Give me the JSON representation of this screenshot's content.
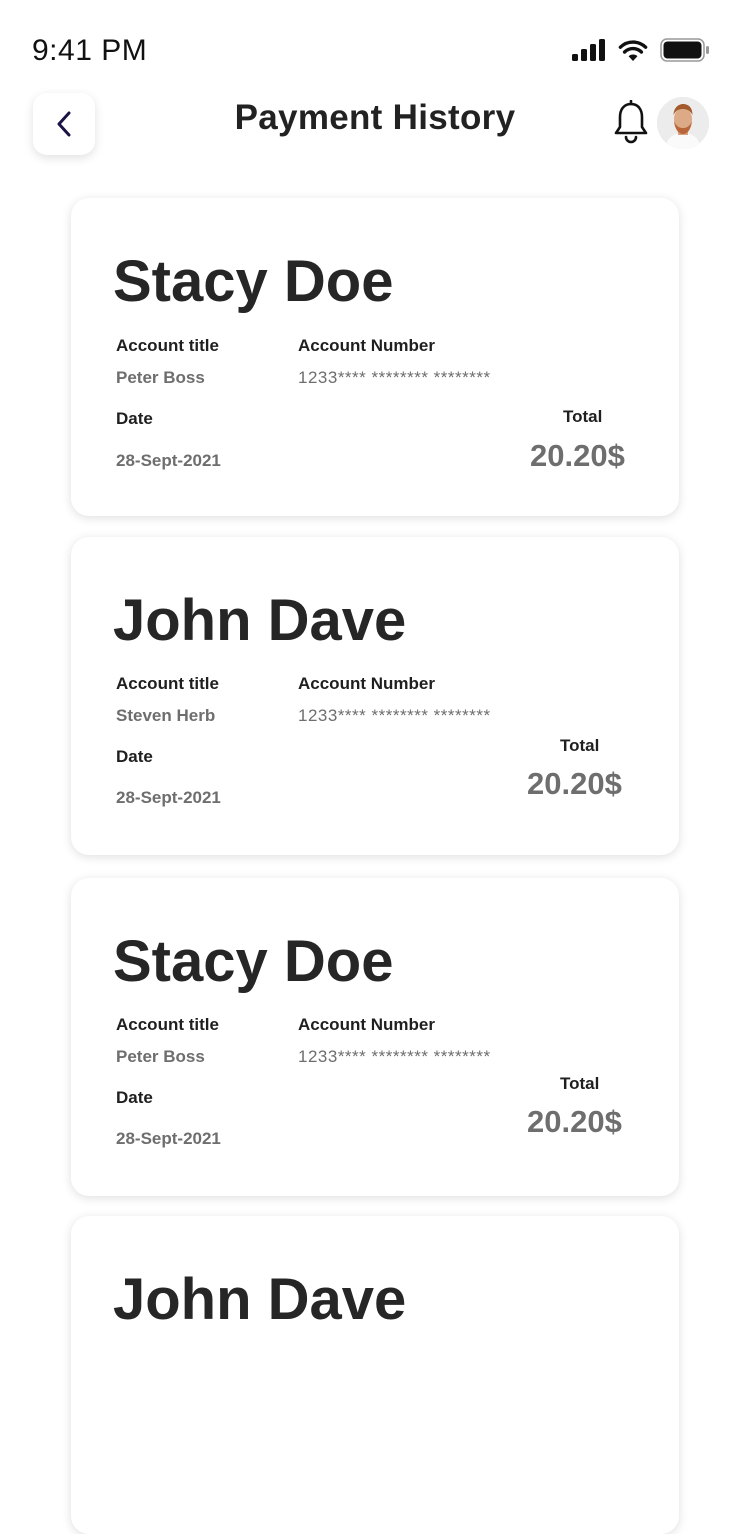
{
  "status_bar": {
    "time": "9:41 PM"
  },
  "header": {
    "title": "Payment History"
  },
  "labels": {
    "account_title": "Account title",
    "account_number": "Account Number",
    "date": "Date",
    "total": "Total"
  },
  "payments": [
    {
      "name": "Stacy Doe",
      "account_title": "Peter Boss",
      "account_number": "1233**** ******** ********",
      "date": "28-Sept-2021",
      "total": "20.20$"
    },
    {
      "name": "John Dave",
      "account_title": "Steven Herb",
      "account_number": "1233**** ******** ********",
      "date": "28-Sept-2021",
      "total": "20.20$"
    },
    {
      "name": "Stacy Doe",
      "account_title": "Peter Boss",
      "account_number": "1233**** ******** ********",
      "date": "28-Sept-2021",
      "total": "20.20$"
    },
    {
      "name": "John Dave"
    }
  ]
}
